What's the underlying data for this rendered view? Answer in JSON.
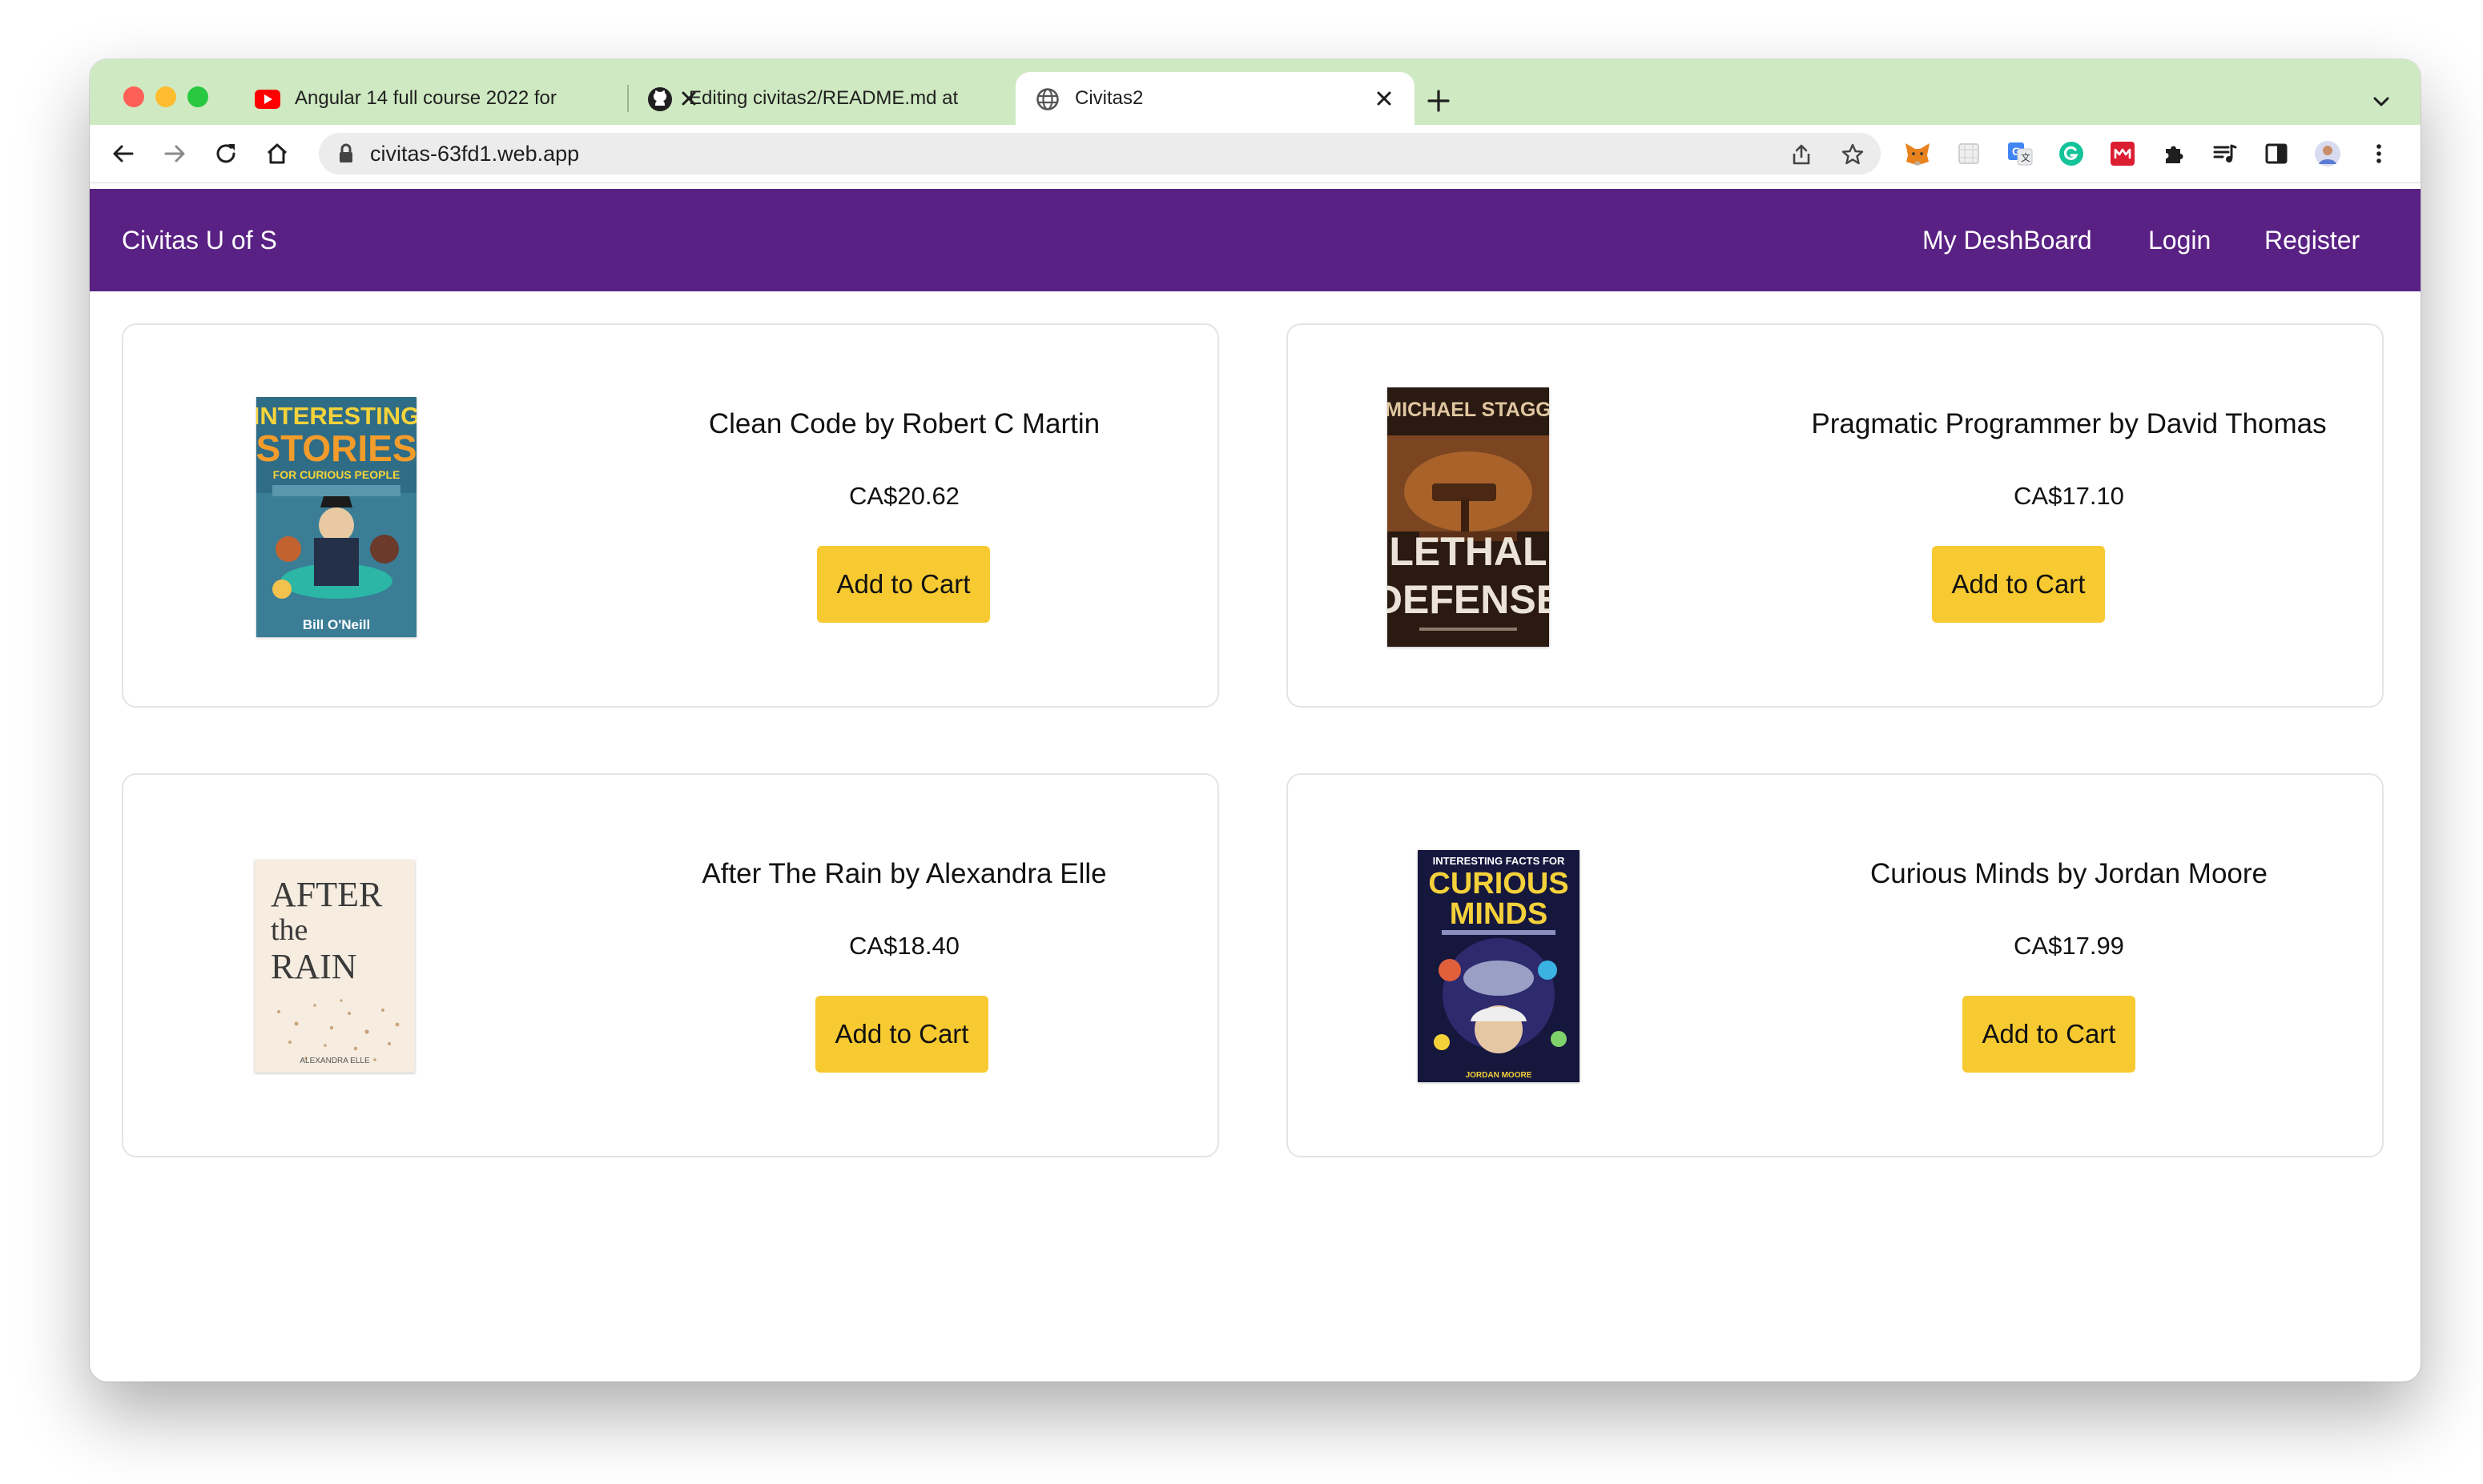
{
  "browser": {
    "tabs": [
      {
        "title": "Angular 14 full course 2022 for",
        "favicon": "youtube-icon",
        "active": false
      },
      {
        "title": "Editing civitas2/README.md at",
        "favicon": "github-icon",
        "active": false
      },
      {
        "title": "Civitas2",
        "favicon": "globe-icon",
        "active": true
      }
    ],
    "address": "civitas-63fd1.web.app"
  },
  "app": {
    "brand": "Civitas U of S",
    "nav": {
      "dashboard": "My DeshBoard",
      "login": "Login",
      "register": "Register"
    },
    "navbar_color": "#5a2184"
  },
  "products": [
    {
      "title": "Clean Code by Robert C Martin",
      "price": "CA$20.62",
      "button": "Add to Cart",
      "cover": {
        "line1": "INTERESTING",
        "line2": "STORIES",
        "line3": "FOR CURIOUS PEOPLE",
        "author": "Bill O'Neill"
      }
    },
    {
      "title": "Pragmatic Programmer by David Thomas",
      "price": "CA$17.10",
      "button": "Add to Cart",
      "cover": {
        "author": "MICHAEL STAGG",
        "line1": "LETHAL",
        "line2": "DEFENSE"
      }
    },
    {
      "title": "After The Rain by Alexandra Elle",
      "price": "CA$18.40",
      "button": "Add to Cart",
      "cover": {
        "line1": "AFTER",
        "line2": "the",
        "line3": "RAIN",
        "author": "ALEXANDRA ELLE"
      }
    },
    {
      "title": "Curious Minds by Jordan Moore",
      "price": "CA$17.99",
      "button": "Add to Cart",
      "cover": {
        "line1": "INTERESTING FACTS FOR",
        "line2": "CURIOUS",
        "line3": "MINDS",
        "author": "JORDAN MOORE"
      }
    }
  ],
  "colors": {
    "button": "#f8ca31",
    "tabstrip": "#cfe9c2"
  }
}
